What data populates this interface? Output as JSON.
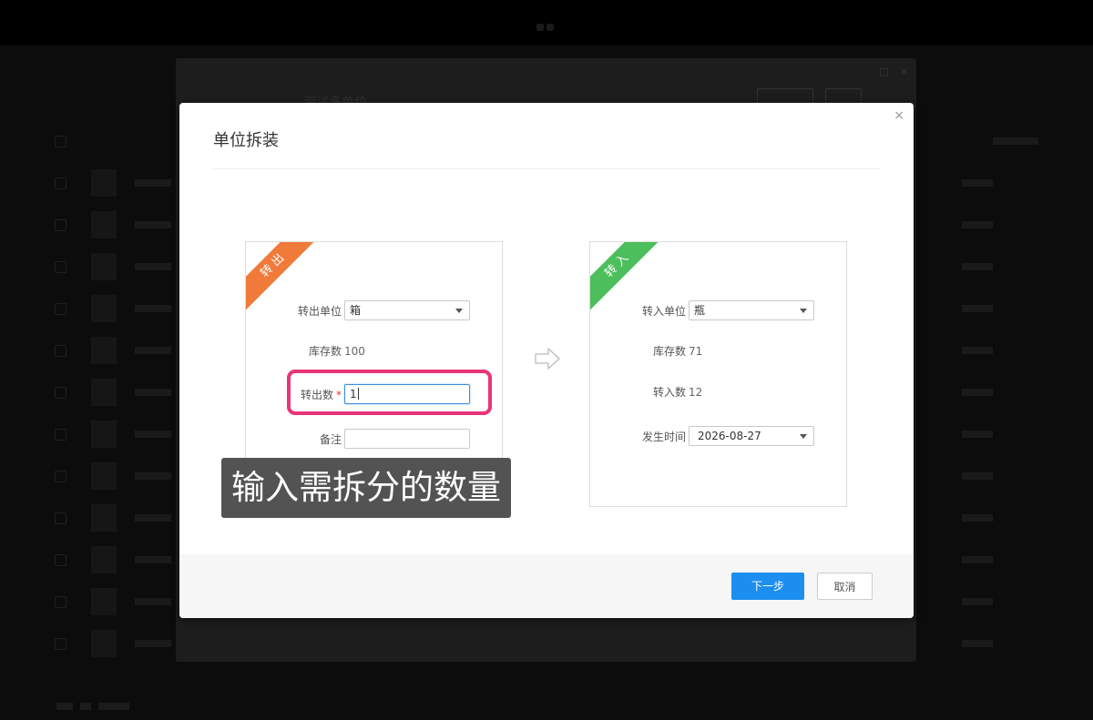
{
  "background": {
    "title": "测试多单位"
  },
  "dialog": {
    "title": "单位拆装",
    "close_glyph": "×",
    "out_panel": {
      "ribbon": "转出",
      "unit_label": "转出单位",
      "unit_value": "箱",
      "stock_label": "库存数",
      "stock_value": "100",
      "qty_label": "转出数",
      "required_mark": "*",
      "qty_value": "1",
      "remark_label": "备注",
      "remark_value": ""
    },
    "in_panel": {
      "ribbon": "转入",
      "unit_label": "转入单位",
      "unit_value": "瓶",
      "stock_label": "库存数",
      "stock_value": "71",
      "qty_label": "转入数",
      "qty_value": "12",
      "date_label": "发生时间",
      "date_value": "2026-08-27"
    },
    "footer": {
      "next_label": "下一步",
      "cancel_label": "取消"
    }
  },
  "caption": "输入需拆分的数量",
  "colors": {
    "out_ribbon": "#f07a3a",
    "in_ribbon": "#4cbf5c",
    "primary_button": "#1b8ef0",
    "highlight_border": "#e8357a"
  },
  "icons": {
    "transfer_arrow": "arrow-right-icon",
    "select_caret": "chevron-down-icon"
  }
}
